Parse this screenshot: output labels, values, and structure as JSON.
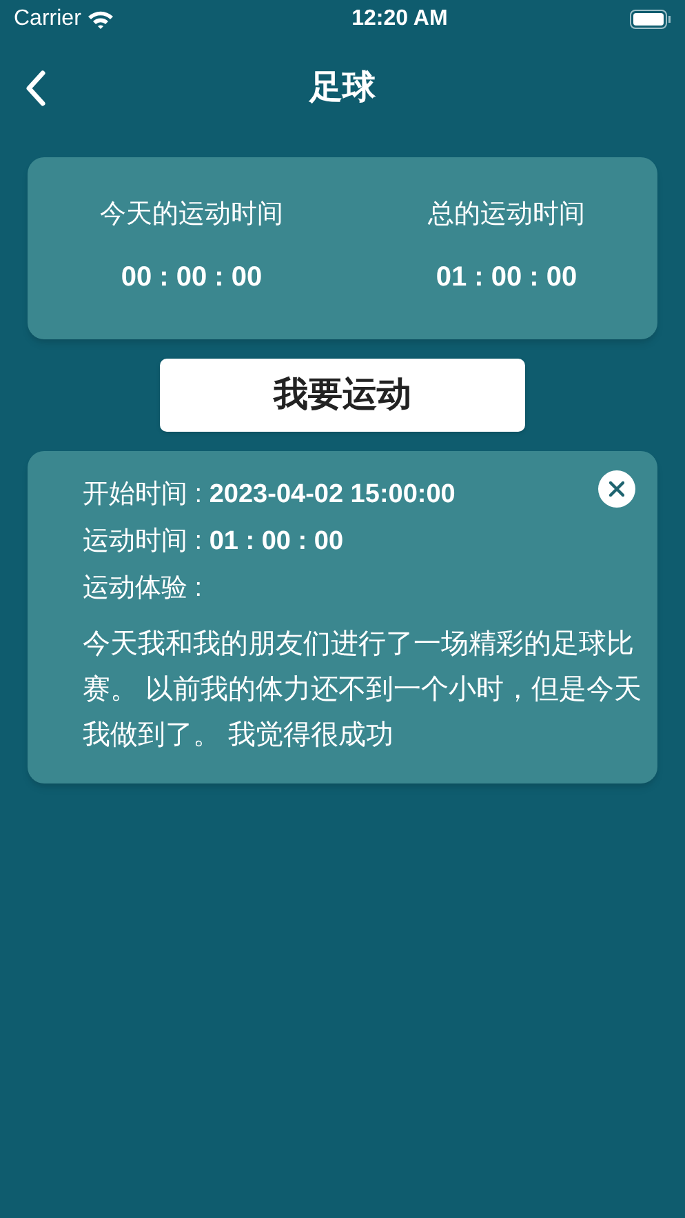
{
  "status_bar": {
    "carrier": "Carrier",
    "time": "12:20 AM"
  },
  "nav": {
    "title": "足球"
  },
  "summary": [
    {
      "label": "今天的运动时间",
      "value": "00 : 00 : 00"
    },
    {
      "label": "总的运动时间",
      "value": "01 : 00 : 00"
    }
  ],
  "start_button": "我要运动",
  "records": [
    {
      "lines": [
        "开始时间 : **2023-04-02 15:00:00**",
        "运动时间 : **01 : 00 : 00**",
        "运动体验 :"
      ],
      "note": "今天我和我的朋友们进行了一场精彩的足球比赛。 以前我的体力还不到一个小时，但是今天我做到了。 我觉得很成功"
    }
  ]
}
